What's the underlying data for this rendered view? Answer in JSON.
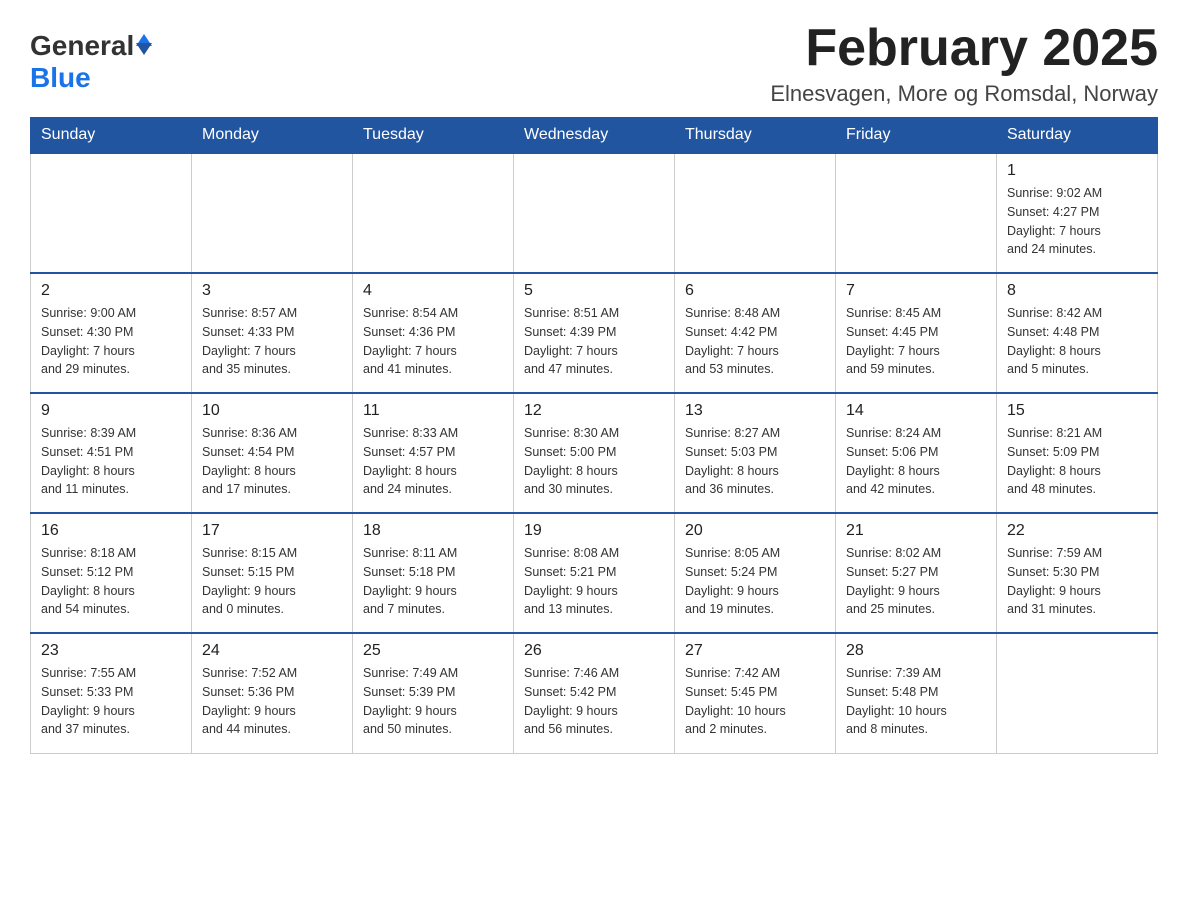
{
  "header": {
    "logo_general": "General",
    "logo_blue": "Blue",
    "month_title": "February 2025",
    "location": "Elnesvagen, More og Romsdal, Norway"
  },
  "days_of_week": [
    "Sunday",
    "Monday",
    "Tuesday",
    "Wednesday",
    "Thursday",
    "Friday",
    "Saturday"
  ],
  "weeks": [
    {
      "days": [
        {
          "number": "",
          "info": "",
          "empty": true
        },
        {
          "number": "",
          "info": "",
          "empty": true
        },
        {
          "number": "",
          "info": "",
          "empty": true
        },
        {
          "number": "",
          "info": "",
          "empty": true
        },
        {
          "number": "",
          "info": "",
          "empty": true
        },
        {
          "number": "",
          "info": "",
          "empty": true
        },
        {
          "number": "1",
          "info": "Sunrise: 9:02 AM\nSunset: 4:27 PM\nDaylight: 7 hours\nand 24 minutes.",
          "empty": false
        }
      ]
    },
    {
      "days": [
        {
          "number": "2",
          "info": "Sunrise: 9:00 AM\nSunset: 4:30 PM\nDaylight: 7 hours\nand 29 minutes.",
          "empty": false
        },
        {
          "number": "3",
          "info": "Sunrise: 8:57 AM\nSunset: 4:33 PM\nDaylight: 7 hours\nand 35 minutes.",
          "empty": false
        },
        {
          "number": "4",
          "info": "Sunrise: 8:54 AM\nSunset: 4:36 PM\nDaylight: 7 hours\nand 41 minutes.",
          "empty": false
        },
        {
          "number": "5",
          "info": "Sunrise: 8:51 AM\nSunset: 4:39 PM\nDaylight: 7 hours\nand 47 minutes.",
          "empty": false
        },
        {
          "number": "6",
          "info": "Sunrise: 8:48 AM\nSunset: 4:42 PM\nDaylight: 7 hours\nand 53 minutes.",
          "empty": false
        },
        {
          "number": "7",
          "info": "Sunrise: 8:45 AM\nSunset: 4:45 PM\nDaylight: 7 hours\nand 59 minutes.",
          "empty": false
        },
        {
          "number": "8",
          "info": "Sunrise: 8:42 AM\nSunset: 4:48 PM\nDaylight: 8 hours\nand 5 minutes.",
          "empty": false
        }
      ]
    },
    {
      "days": [
        {
          "number": "9",
          "info": "Sunrise: 8:39 AM\nSunset: 4:51 PM\nDaylight: 8 hours\nand 11 minutes.",
          "empty": false
        },
        {
          "number": "10",
          "info": "Sunrise: 8:36 AM\nSunset: 4:54 PM\nDaylight: 8 hours\nand 17 minutes.",
          "empty": false
        },
        {
          "number": "11",
          "info": "Sunrise: 8:33 AM\nSunset: 4:57 PM\nDaylight: 8 hours\nand 24 minutes.",
          "empty": false
        },
        {
          "number": "12",
          "info": "Sunrise: 8:30 AM\nSunset: 5:00 PM\nDaylight: 8 hours\nand 30 minutes.",
          "empty": false
        },
        {
          "number": "13",
          "info": "Sunrise: 8:27 AM\nSunset: 5:03 PM\nDaylight: 8 hours\nand 36 minutes.",
          "empty": false
        },
        {
          "number": "14",
          "info": "Sunrise: 8:24 AM\nSunset: 5:06 PM\nDaylight: 8 hours\nand 42 minutes.",
          "empty": false
        },
        {
          "number": "15",
          "info": "Sunrise: 8:21 AM\nSunset: 5:09 PM\nDaylight: 8 hours\nand 48 minutes.",
          "empty": false
        }
      ]
    },
    {
      "days": [
        {
          "number": "16",
          "info": "Sunrise: 8:18 AM\nSunset: 5:12 PM\nDaylight: 8 hours\nand 54 minutes.",
          "empty": false
        },
        {
          "number": "17",
          "info": "Sunrise: 8:15 AM\nSunset: 5:15 PM\nDaylight: 9 hours\nand 0 minutes.",
          "empty": false
        },
        {
          "number": "18",
          "info": "Sunrise: 8:11 AM\nSunset: 5:18 PM\nDaylight: 9 hours\nand 7 minutes.",
          "empty": false
        },
        {
          "number": "19",
          "info": "Sunrise: 8:08 AM\nSunset: 5:21 PM\nDaylight: 9 hours\nand 13 minutes.",
          "empty": false
        },
        {
          "number": "20",
          "info": "Sunrise: 8:05 AM\nSunset: 5:24 PM\nDaylight: 9 hours\nand 19 minutes.",
          "empty": false
        },
        {
          "number": "21",
          "info": "Sunrise: 8:02 AM\nSunset: 5:27 PM\nDaylight: 9 hours\nand 25 minutes.",
          "empty": false
        },
        {
          "number": "22",
          "info": "Sunrise: 7:59 AM\nSunset: 5:30 PM\nDaylight: 9 hours\nand 31 minutes.",
          "empty": false
        }
      ]
    },
    {
      "days": [
        {
          "number": "23",
          "info": "Sunrise: 7:55 AM\nSunset: 5:33 PM\nDaylight: 9 hours\nand 37 minutes.",
          "empty": false
        },
        {
          "number": "24",
          "info": "Sunrise: 7:52 AM\nSunset: 5:36 PM\nDaylight: 9 hours\nand 44 minutes.",
          "empty": false
        },
        {
          "number": "25",
          "info": "Sunrise: 7:49 AM\nSunset: 5:39 PM\nDaylight: 9 hours\nand 50 minutes.",
          "empty": false
        },
        {
          "number": "26",
          "info": "Sunrise: 7:46 AM\nSunset: 5:42 PM\nDaylight: 9 hours\nand 56 minutes.",
          "empty": false
        },
        {
          "number": "27",
          "info": "Sunrise: 7:42 AM\nSunset: 5:45 PM\nDaylight: 10 hours\nand 2 minutes.",
          "empty": false
        },
        {
          "number": "28",
          "info": "Sunrise: 7:39 AM\nSunset: 5:48 PM\nDaylight: 10 hours\nand 8 minutes.",
          "empty": false
        },
        {
          "number": "",
          "info": "",
          "empty": true
        }
      ]
    }
  ]
}
